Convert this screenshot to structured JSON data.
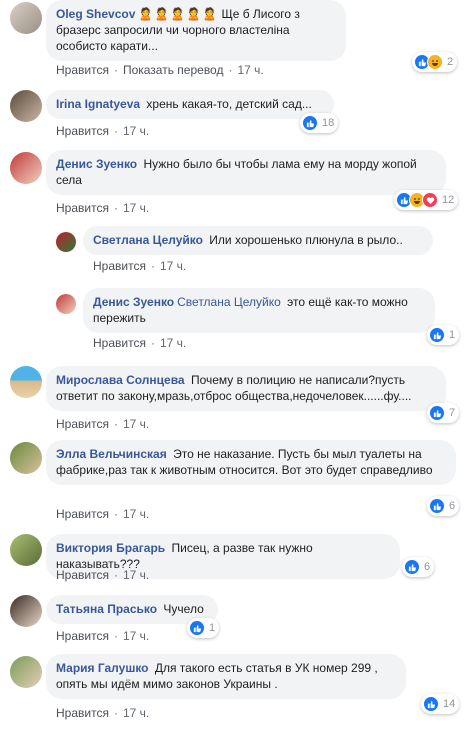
{
  "ui": {
    "like_label": "Нравится",
    "translate_label": "Показать перевод",
    "dot": "·"
  },
  "colors": {
    "name": "#385898",
    "bubble": "#f2f3f5",
    "like": "#1877f2",
    "haha": "#f7b125",
    "love": "#f33e58"
  },
  "comments": [
    {
      "author": "Oleg Shevcov",
      "author_suffix": "🙎🙎🙎🙎🙎",
      "text": "Ще б Лисого з бразерс запросили чи чорного властеліна особисто карати...",
      "time": "17 ч.",
      "reactions": [
        "like-icon",
        "haha-icon"
      ],
      "count": "2"
    },
    {
      "author": "Irina Ignatyeva",
      "text": "хрень какая-то, детский сад...",
      "time": "17 ч.",
      "reactions": [
        "like-icon"
      ],
      "count": "18"
    },
    {
      "author": "Денис Зуенко",
      "text": "Нужно было бы чтобы лама ему на морду жопой села",
      "time": "17 ч.",
      "reactions": [
        "like-icon",
        "haha-icon",
        "love-icon"
      ],
      "count": "12"
    },
    {
      "author": "Светлана Целуйко",
      "text": "Или хорошенько плюнула в рыло..",
      "time": "17 ч."
    },
    {
      "author": "Денис Зуенко",
      "mention": "Светлана Целуйко",
      "text": "это ещё как-то можно пережить",
      "time": "17 ч.",
      "reactions": [
        "like-icon"
      ],
      "count": "1"
    },
    {
      "author": "Мирослава Солнцева",
      "text": "Почему в полицию не написали?пусть ответит по закону,мразь,отброс общества,недочеловек......фу....",
      "time": "17 ч.",
      "reactions": [
        "like-icon"
      ],
      "count": "7"
    },
    {
      "author": "Элла Вельчинская",
      "text": "Это не наказание. Пусть бы мыл туалеты на фабрике,раз так к животным относится. Вот это будет справедливо",
      "time": "17 ч.",
      "reactions": [
        "like-icon"
      ],
      "count": "6"
    },
    {
      "author": "Виктория Брагарь",
      "text": "Писец, а разве так нужно наказывать???",
      "time": "17 ч.",
      "reactions": [
        "like-icon"
      ],
      "count": "6"
    },
    {
      "author": "Татьяна Прасько",
      "text": "Чучело",
      "time": "17 ч.",
      "reactions": [
        "like-icon"
      ],
      "count": "1"
    },
    {
      "author": "Мария Галушко",
      "text": "Для такого есть статья в УК номер 299 , опять мы идём мимо законов Украины .",
      "time": "17 ч.",
      "reactions": [
        "like-icon"
      ],
      "count": "14"
    }
  ]
}
